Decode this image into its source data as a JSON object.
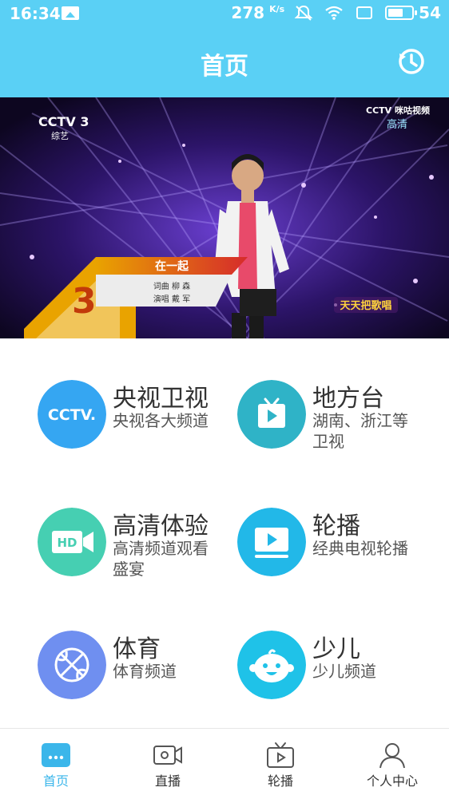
{
  "status_bar": {
    "time": "16:34",
    "net_speed": "278",
    "net_speed_unit": "K/s",
    "battery": "54"
  },
  "header": {
    "title": "首页",
    "history_icon": "history-icon"
  },
  "video": {
    "channel_logo": "CCTV 3",
    "channel_sub": "综艺",
    "corner_logo": "CCTV 咪咕视频",
    "corner_sub": "高清",
    "song_title": "在一起",
    "credit_line1": "词曲 柳  森",
    "credit_line2": "演唱 戴  军",
    "show_logo": "天天把歌唱"
  },
  "categories": [
    {
      "name": "央视卫视",
      "desc": "央视各大频道",
      "icon": "cctv-icon",
      "color": "#35a6f2"
    },
    {
      "name": "地方台",
      "desc": "湖南、浙江等卫视",
      "icon": "tv-icon",
      "color": "#2fb3c7"
    },
    {
      "name": "高清体验",
      "desc": "高清频道观看盛宴",
      "icon": "hd-camera-icon",
      "color": "#46cfb2"
    },
    {
      "name": "轮播",
      "desc": "经典电视轮播",
      "icon": "play-screen-icon",
      "color": "#22b8e8"
    },
    {
      "name": "体育",
      "desc": "体育频道",
      "icon": "basketball-icon",
      "color": "#6f8ff0"
    },
    {
      "name": "少儿",
      "desc": "少儿频道",
      "icon": "baby-face-icon",
      "color": "#1fc2e8"
    }
  ],
  "tabs": [
    {
      "label": "首页",
      "icon": "home-icon",
      "active": true
    },
    {
      "label": "直播",
      "icon": "video-camera-icon",
      "active": false
    },
    {
      "label": "轮播",
      "icon": "tv-play-icon",
      "active": false
    },
    {
      "label": "个人中心",
      "icon": "person-icon",
      "active": false
    }
  ],
  "colors": {
    "header_bg": "#5ad0f5",
    "tab_active": "#3bb6ea"
  }
}
